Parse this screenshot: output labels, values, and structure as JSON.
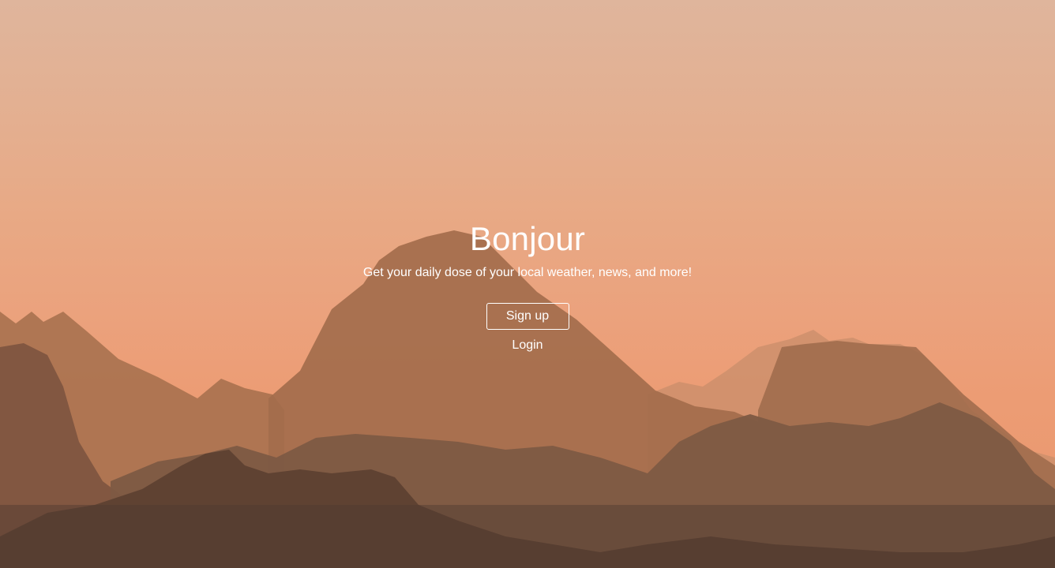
{
  "hero": {
    "title": "Bonjour",
    "subtitle": "Get your daily dose of your local weather, news, and more!",
    "signup_label": "Sign up",
    "login_label": "Login"
  },
  "background": {
    "sky_top_color": "#dfb59c",
    "sky_bottom_color": "#ec9c74",
    "description_icon": "mountain-landscape"
  },
  "colors": {
    "text": "#ffffff"
  }
}
